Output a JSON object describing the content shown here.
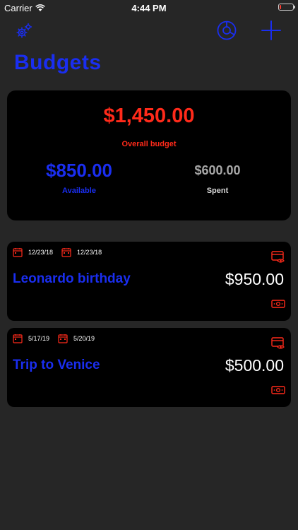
{
  "status_bar": {
    "carrier": "Carrier",
    "time": "4:44 PM",
    "battery_level_fraction": 0.1
  },
  "nav": {
    "title": "Budgets",
    "icons": [
      "gears-icon",
      "pie-chart-icon",
      "plus-icon"
    ]
  },
  "summary": {
    "overall_amount": "$1,450.00",
    "overall_label": "Overall budget",
    "available_amount": "$850.00",
    "available_label": "Available",
    "spent_amount": "$600.00",
    "spent_label": "Spent"
  },
  "budgets": [
    {
      "start_date": "12/23/18",
      "end_date": "12/23/18",
      "name": "Leonardo birthday",
      "amount": "$950.00"
    },
    {
      "start_date": "5/17/19",
      "end_date": "5/20/19",
      "name": "Trip to Venice",
      "amount": "$500.00"
    }
  ],
  "colors": {
    "background": "#262626",
    "card": "#000000",
    "accent_blue": "#1a2ef0",
    "accent_red": "#ff2a1a",
    "muted_gray": "#a7a7a7"
  }
}
